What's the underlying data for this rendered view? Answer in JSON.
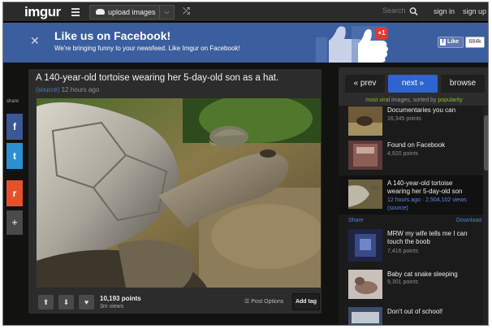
{
  "nav": {
    "logo": "imgur",
    "upload_label": "upload images",
    "search_placeholder": "Search",
    "signin": "sign in",
    "signup": "sign up"
  },
  "banner": {
    "title": "Like us on Facebook!",
    "subtitle": "We're bringing funny to your newsfeed. Like Imgur on Facebook!",
    "plus_badge": "+1",
    "like_label": "Like",
    "like_count": "684k"
  },
  "share": {
    "label": "share",
    "facebook": "f",
    "twitter": "t",
    "reddit": "r",
    "more": "+"
  },
  "post": {
    "title": "A 140-year-old tortoise wearing her 5-day-old son as a hat.",
    "source": "(source)",
    "time": "12 hours ago",
    "points": "10,193 points",
    "views": "3m views",
    "post_options": "Post Options",
    "add_tag": "Add tag"
  },
  "sidebar": {
    "prev": "« prev",
    "next": "next »",
    "browse": "browse",
    "viral_prefix": "most viral",
    "viral_middle": "images, sorted by",
    "viral_sort": "popularity",
    "share_left": "Share",
    "share_right": "Download",
    "items": [
      {
        "title": "Documentaries you can",
        "sub": "16,345 points"
      },
      {
        "title": "Found on Facebook",
        "sub": "4,920 points"
      },
      {
        "title": "A 140-year-old tortoise wearing her 5-day-old son",
        "sub_time": "12 hours ago",
        "sub_views": "· 2,504,102 views",
        "sub_source": "(source)"
      },
      {
        "title": "MRW my wife tells me I can touch the boob",
        "sub": "7,416 points"
      },
      {
        "title": "Baby cat snake sleeping",
        "sub": "9,301 points"
      },
      {
        "title": "Don't out of school!",
        "sub": ""
      }
    ]
  },
  "colors": {
    "accent_blue": "#2d64cf",
    "facebook_blue": "#3b5e9e",
    "viral_green": "#85bf25",
    "reddit_orange": "#e5522a"
  }
}
